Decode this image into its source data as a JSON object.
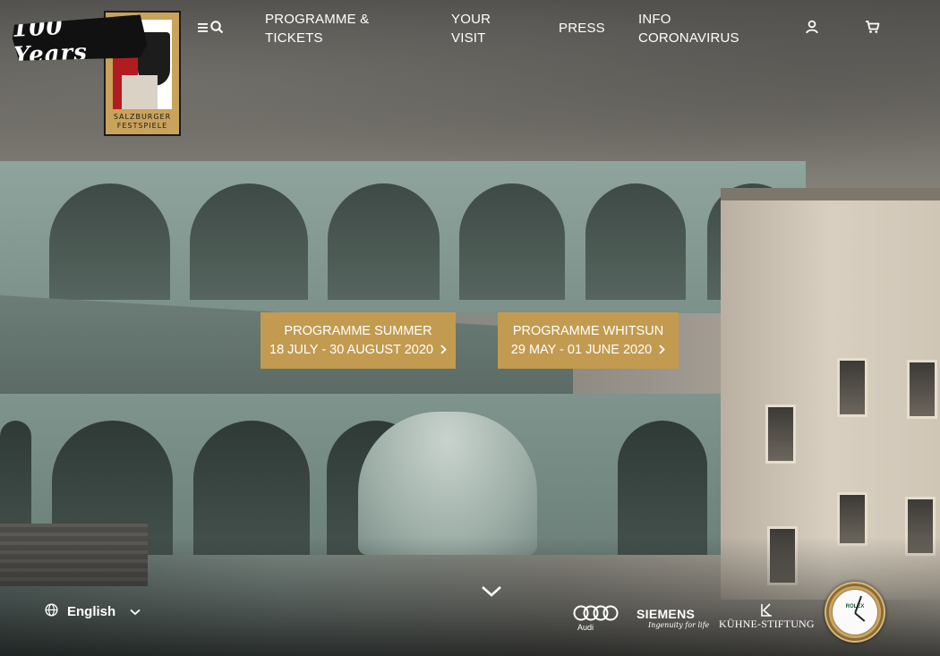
{
  "brand": {
    "badge_text": "100 Years",
    "logo_text_line1": "SALZBURGER",
    "logo_text_line2": "FESTSPIELE",
    "colors": {
      "gold": "#c29b50",
      "red": "#b11c22"
    }
  },
  "nav": {
    "menu_icon": "menu-icon",
    "search_icon": "search-icon",
    "items": [
      {
        "line1": "PROGRAMME &",
        "line2": "TICKETS"
      },
      {
        "line1": "YOUR",
        "line2": "VISIT"
      },
      {
        "line1": "PRESS",
        "line2": ""
      },
      {
        "line1": "INFO",
        "line2": "CORONAVIRUS"
      }
    ],
    "account_icon": "user-icon",
    "cart_icon": "cart-icon"
  },
  "ctas": [
    {
      "title": "PROGRAMME SUMMER",
      "dates": "18 JULY - 30 AUGUST 2020"
    },
    {
      "title": "PROGRAMME WHITSUN",
      "dates": "29 MAY - 01 JUNE 2020"
    }
  ],
  "scroll_icon": "chevron-down-icon",
  "language": {
    "icon": "globe-icon",
    "label": "English",
    "dropdown_icon": "chevron-down-icon"
  },
  "sponsors": {
    "audi": "Audi",
    "siemens": "SIEMENS",
    "siemens_tagline": "Ingenuity for life",
    "kuehne": "KÜHNE-STIFTUNG",
    "rolex": "ROLEX"
  }
}
